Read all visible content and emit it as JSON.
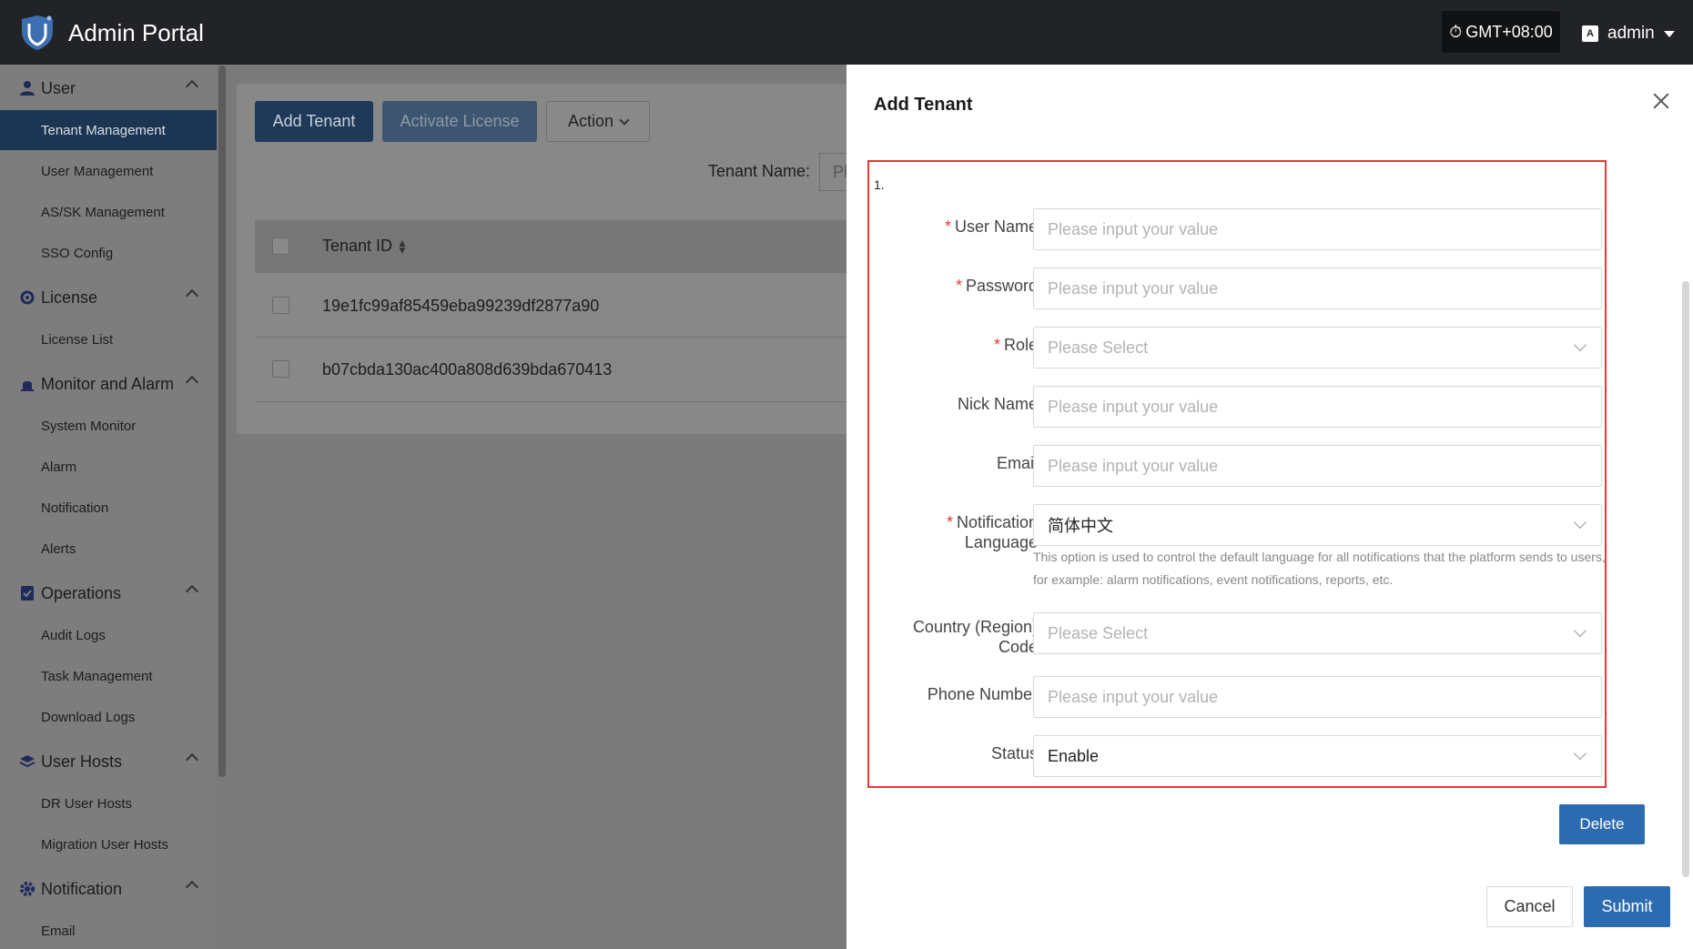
{
  "header": {
    "app_title": "Admin Portal",
    "timezone": "GMT+08:00",
    "user": "admin"
  },
  "sidebar": {
    "groups": [
      {
        "label": "User",
        "icon": "user-icon",
        "items": [
          "Tenant Management",
          "User Management",
          "AS/SK Management",
          "SSO Config"
        ]
      },
      {
        "label": "License",
        "icon": "license-icon",
        "items": [
          "License List"
        ]
      },
      {
        "label": "Monitor and Alarm",
        "icon": "alarm-icon",
        "items": [
          "System Monitor",
          "Alarm",
          "Notification",
          "Alerts"
        ]
      },
      {
        "label": "Operations",
        "icon": "operations-icon",
        "items": [
          "Audit Logs",
          "Task Management",
          "Download Logs"
        ]
      },
      {
        "label": "User Hosts",
        "icon": "layers-icon",
        "items": [
          "DR User Hosts",
          "Migration User Hosts"
        ]
      },
      {
        "label": "Notification",
        "icon": "gear-icon",
        "items": [
          "Email"
        ]
      }
    ],
    "active_item": "Tenant Management"
  },
  "toolbar": {
    "add_tenant": "Add Tenant",
    "activate_license": "Activate License",
    "action": "Action"
  },
  "filter": {
    "tenant_name_label": "Tenant Name:",
    "tenant_name_placeholder": "Pl"
  },
  "table": {
    "columns": [
      "Tenant ID"
    ],
    "rows": [
      {
        "tenant_id": "19e1fc99af85459eba99239df2877a90"
      },
      {
        "tenant_id": "b07cbda130ac400a808d639bda670413"
      }
    ]
  },
  "drawer": {
    "title": "Add Tenant",
    "form_index": "1.",
    "fields": {
      "user_name": {
        "label": "User Name",
        "required": true,
        "placeholder": "Please input your value"
      },
      "password": {
        "label": "Password",
        "required": true,
        "placeholder": "Please input your value"
      },
      "role": {
        "label": "Role",
        "required": true,
        "placeholder": "Please Select"
      },
      "nick_name": {
        "label": "Nick Name",
        "required": false,
        "placeholder": "Please input your value"
      },
      "email": {
        "label": "Email",
        "required": false,
        "placeholder": "Please input your value"
      },
      "notification_language": {
        "label_line1": "Notification",
        "label_line2": "Language",
        "required": true,
        "value": "简体中文",
        "hint_line1": "This option is used to control the default language for all notifications that the platform sends to users,",
        "hint_line2": "for example: alarm notifications, event notifications, reports, etc."
      },
      "country_code": {
        "label_line1": "Country (Region)",
        "label_line2": "Code",
        "required": false,
        "placeholder": "Please Select"
      },
      "phone_number": {
        "label": "Phone Number",
        "required": false,
        "placeholder": "Please input your value"
      },
      "status": {
        "label": "Status",
        "required": false,
        "value": "Enable"
      }
    },
    "delete_label": "Delete",
    "cancel_label": "Cancel",
    "submit_label": "Submit"
  },
  "colors": {
    "primary": "#2d6bb0",
    "required": "#e53935",
    "topbar": "#222326"
  }
}
